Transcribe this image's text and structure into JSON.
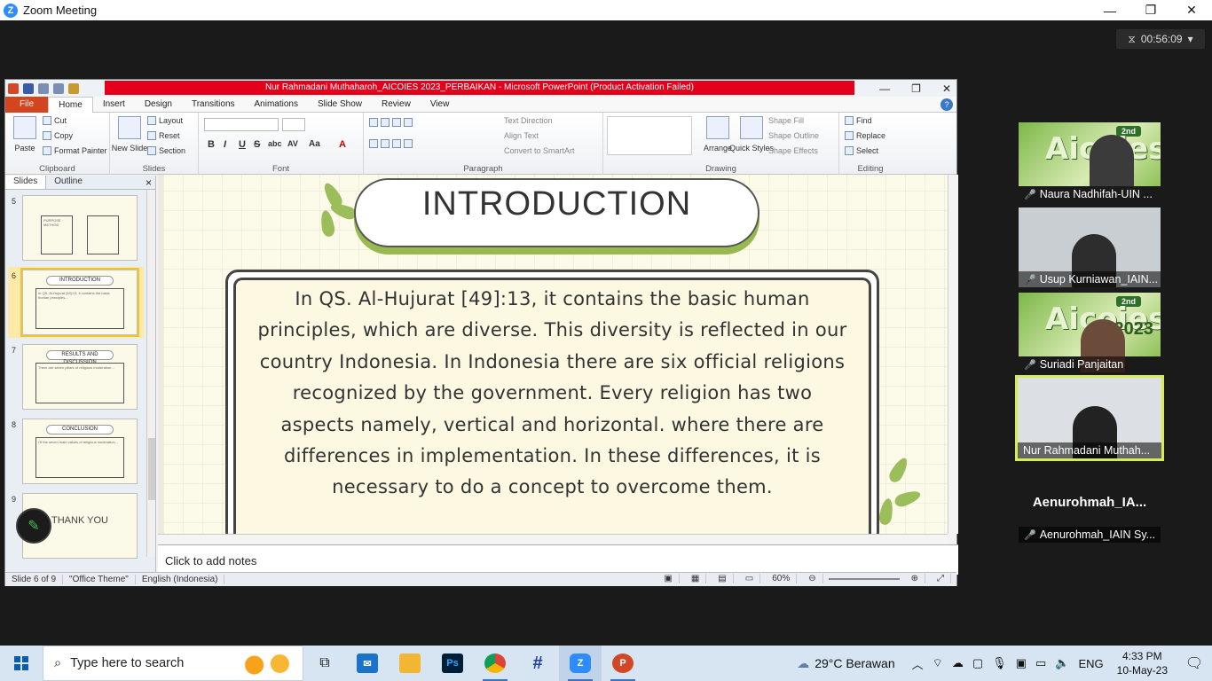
{
  "zoom": {
    "title": "Zoom Meeting",
    "logo": "Z",
    "timer": "00:56:09",
    "window_controls": [
      "—",
      "❐",
      "✕"
    ]
  },
  "ppt": {
    "title": "Nur Rahmadani Muthaharoh_AICOIES 2023_PERBAIKAN - Microsoft PowerPoint (Product Activation Failed)",
    "tabs": [
      "File",
      "Home",
      "Insert",
      "Design",
      "Transitions",
      "Animations",
      "Slide Show",
      "Review",
      "View"
    ],
    "active_tab": "Home",
    "ribbon": {
      "clipboard": {
        "label": "Clipboard",
        "paste": "Paste",
        "cut": "Cut",
        "copy": "Copy",
        "format_painter": "Format Painter"
      },
      "slides": {
        "label": "Slides",
        "new_slide": "New Slide",
        "layout": "Layout",
        "reset": "Reset",
        "section": "Section"
      },
      "font": {
        "label": "Font",
        "bold": "B",
        "italic": "I",
        "underline": "U",
        "strike": "S",
        "shadow": "abc",
        "spacing": "AV",
        "case": "Aa",
        "color": "A"
      },
      "paragraph": {
        "label": "Paragraph",
        "text_direction": "Text Direction",
        "align_text": "Align Text",
        "convert_smartart": "Convert to SmartArt"
      },
      "drawing": {
        "label": "Drawing",
        "arrange": "Arrange",
        "quick_styles": "Quick Styles",
        "shape_fill": "Shape Fill",
        "shape_outline": "Shape Outline",
        "shape_effects": "Shape Effects"
      },
      "editing": {
        "label": "Editing",
        "find": "Find",
        "replace": "Replace",
        "select": "Select"
      }
    },
    "pane_tabs": [
      "Slides",
      "Outline"
    ],
    "thumbnails": [
      {
        "num": "5",
        "title": "",
        "text": "PURPOSE · METHOD"
      },
      {
        "num": "6",
        "title": "INTRODUCTION",
        "text": "In QS. Al-Hujurat [49]:13, it contains the basic human principles..."
      },
      {
        "num": "7",
        "title": "RESULTS AND DISCUSSION",
        "text": "There are seven pillars of religious moderation..."
      },
      {
        "num": "8",
        "title": "CONCLUSION",
        "text": "Of the seven main values of religious moderation..."
      },
      {
        "num": "9",
        "title": "THANK YOU",
        "text": ""
      }
    ],
    "slide": {
      "title": "INTRODUCTION",
      "body": "In QS. Al-Hujurat [49]:13, it contains the basic human principles, which are diverse. This diversity is reflected in our country Indonesia. In Indonesia there are six official religions recognized by the government. Every religion has two aspects namely, vertical and horizontal. where there are differences in implementation. In these differences, it is necessary to do a concept to overcome them."
    },
    "notes_placeholder": "Click to add notes",
    "status": {
      "slide": "Slide 6 of 9",
      "theme": "\"Office Theme\"",
      "language": "English (Indonesia)",
      "zoom": "60%"
    }
  },
  "participants": [
    {
      "name": "Naura Nadhifah-UIN ...",
      "muted": true,
      "banner": true
    },
    {
      "name": "Usup Kurniawan_IAIN...",
      "muted": true,
      "banner": false
    },
    {
      "name": "Suriadi Panjaitan",
      "muted": true,
      "banner": true
    },
    {
      "name": "Nur Rahmadani Muthah...",
      "muted": false,
      "banner": false,
      "active": true
    },
    {
      "name": "Aenurohmah_IAIN Sy...",
      "display": "Aenurohmah_IA...",
      "muted": true
    }
  ],
  "banner": {
    "brand": "Aicoies",
    "edition": "2nd",
    "year": "2023"
  },
  "taskbar": {
    "search_placeholder": "Type here to search",
    "weather": "29°C  Berawan",
    "language": "ENG",
    "time": "4:33 PM",
    "date": "10-May-23",
    "colors": {
      "zoom": "#2d8cff",
      "powerpoint": "#d24726",
      "photoshop": "#001e36"
    }
  }
}
